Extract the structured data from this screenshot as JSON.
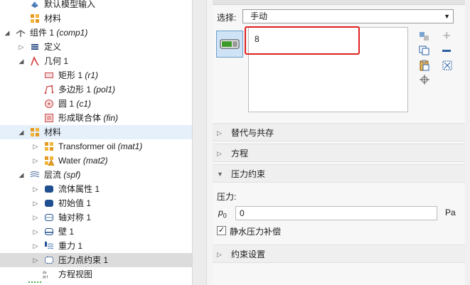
{
  "tree": {
    "rows": [
      {
        "label": "默认模型输入",
        "tag": "",
        "icon": "model-input-icon"
      },
      {
        "label": "材料",
        "tag": "",
        "icon": "materials-icon"
      },
      {
        "label": "组件 1 ",
        "tag": "(comp1)",
        "icon": "component-icon"
      },
      {
        "label": "定义",
        "tag": "",
        "icon": "definitions-icon"
      },
      {
        "label": "几何 1",
        "tag": "",
        "icon": "geometry-icon"
      },
      {
        "label": "矩形 1 ",
        "tag": "(r1)",
        "icon": "rectangle-icon"
      },
      {
        "label": "多边形 1 ",
        "tag": "(pol1)",
        "icon": "polygon-icon"
      },
      {
        "label": "圆 1 ",
        "tag": "(c1)",
        "icon": "circle-icon"
      },
      {
        "label": "形成联合体 ",
        "tag": "(fin)",
        "icon": "union-icon"
      },
      {
        "label": "材料",
        "tag": "",
        "icon": "materials-icon"
      },
      {
        "label": "Transformer oil ",
        "tag": "(mat1)",
        "icon": "material-icon"
      },
      {
        "label": "Water ",
        "tag": "(mat2)",
        "icon": "material-warning-icon"
      },
      {
        "label": "层流 ",
        "tag": "(spf)",
        "icon": "laminar-flow-icon"
      },
      {
        "label": "流体属性 1",
        "tag": "",
        "icon": "fluid-properties-icon"
      },
      {
        "label": "初始值 1",
        "tag": "",
        "icon": "initial-values-icon"
      },
      {
        "label": "轴对称 1",
        "tag": "",
        "icon": "axial-symmetry-icon"
      },
      {
        "label": "壁 1",
        "tag": "",
        "icon": "wall-icon"
      },
      {
        "label": "重力 1",
        "tag": "",
        "icon": "gravity-icon"
      },
      {
        "label": "压力点约束 1",
        "tag": "",
        "icon": "pressure-point-icon"
      },
      {
        "label": "方程视图",
        "tag": "",
        "icon": "equation-view-icon"
      }
    ]
  },
  "settings": {
    "selection_label": "选择:",
    "selection_value": "手动",
    "list_items": [
      "8"
    ],
    "sections": {
      "override": "替代与共存",
      "equation": "方程",
      "pressure_constraint": "压力约束",
      "constraint_settings": "约束设置"
    },
    "pressure_label": "压力:",
    "p0_symbol": "p",
    "p0_sub": "0",
    "p0_value": "0",
    "p0_unit": "Pa",
    "hydrostatic_checked": true,
    "hydrostatic_label": "静水压力补偿"
  },
  "colors": {
    "accent": "#1f6fbf",
    "highlight": "#e02020",
    "selected_row": "#e6f0fb"
  }
}
